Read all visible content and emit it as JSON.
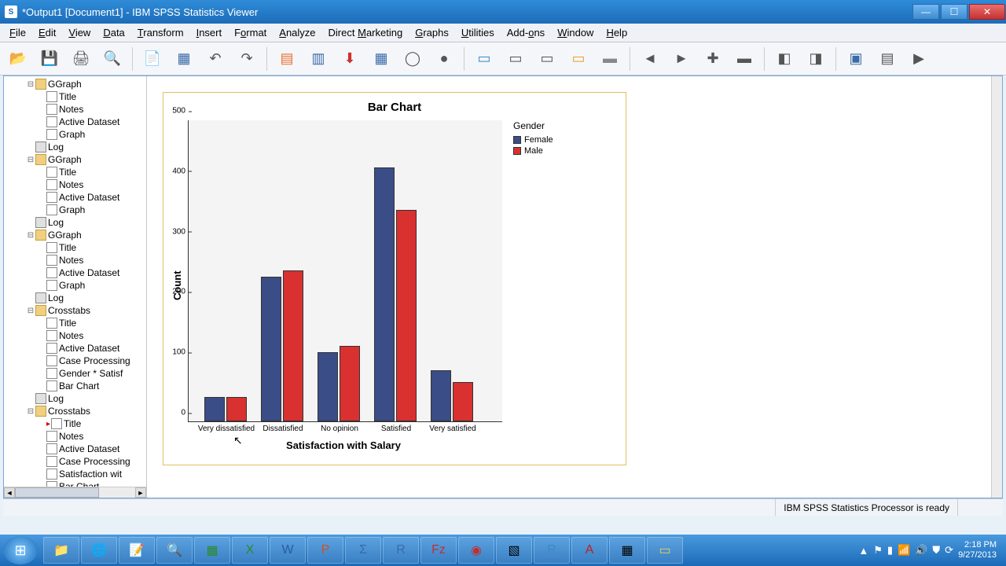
{
  "window": {
    "title": "*Output1 [Document1] - IBM SPSS Statistics Viewer"
  },
  "menu": {
    "file": "File",
    "edit": "Edit",
    "view": "View",
    "data": "Data",
    "transform": "Transform",
    "insert": "Insert",
    "format": "Format",
    "analyze": "Analyze",
    "direct_marketing": "Direct Marketing",
    "graphs": "Graphs",
    "utilities": "Utilities",
    "addons": "Add-ons",
    "window": "Window",
    "help": "Help"
  },
  "outline": {
    "items": [
      {
        "indent": 2,
        "twisty": "-",
        "ico": "book",
        "label": "GGraph"
      },
      {
        "indent": 3,
        "ico": "page",
        "label": "Title"
      },
      {
        "indent": 3,
        "ico": "page",
        "label": "Notes"
      },
      {
        "indent": 3,
        "ico": "page",
        "label": "Active Dataset"
      },
      {
        "indent": 3,
        "ico": "page",
        "label": "Graph"
      },
      {
        "indent": 2,
        "ico": "log",
        "label": "Log"
      },
      {
        "indent": 2,
        "twisty": "-",
        "ico": "book",
        "label": "GGraph"
      },
      {
        "indent": 3,
        "ico": "page",
        "label": "Title"
      },
      {
        "indent": 3,
        "ico": "page",
        "label": "Notes"
      },
      {
        "indent": 3,
        "ico": "page",
        "label": "Active Dataset"
      },
      {
        "indent": 3,
        "ico": "page",
        "label": "Graph"
      },
      {
        "indent": 2,
        "ico": "log",
        "label": "Log"
      },
      {
        "indent": 2,
        "twisty": "-",
        "ico": "book",
        "label": "GGraph"
      },
      {
        "indent": 3,
        "ico": "page",
        "label": "Title"
      },
      {
        "indent": 3,
        "ico": "page",
        "label": "Notes"
      },
      {
        "indent": 3,
        "ico": "page",
        "label": "Active Dataset"
      },
      {
        "indent": 3,
        "ico": "page",
        "label": "Graph"
      },
      {
        "indent": 2,
        "ico": "log",
        "label": "Log"
      },
      {
        "indent": 2,
        "twisty": "-",
        "ico": "book",
        "label": "Crosstabs"
      },
      {
        "indent": 3,
        "ico": "page",
        "label": "Title"
      },
      {
        "indent": 3,
        "ico": "page",
        "label": "Notes"
      },
      {
        "indent": 3,
        "ico": "page",
        "label": "Active Dataset"
      },
      {
        "indent": 3,
        "ico": "page",
        "label": "Case Processing"
      },
      {
        "indent": 3,
        "ico": "page",
        "label": "Gender * Satisf"
      },
      {
        "indent": 3,
        "ico": "page",
        "label": "Bar Chart"
      },
      {
        "indent": 2,
        "ico": "log",
        "label": "Log"
      },
      {
        "indent": 2,
        "twisty": "-",
        "ico": "book",
        "label": "Crosstabs"
      },
      {
        "indent": 3,
        "ico": "page",
        "label": "Title",
        "current": true
      },
      {
        "indent": 3,
        "ico": "page",
        "label": "Notes"
      },
      {
        "indent": 3,
        "ico": "page",
        "label": "Active Dataset"
      },
      {
        "indent": 3,
        "ico": "page",
        "label": "Case Processing"
      },
      {
        "indent": 3,
        "ico": "page",
        "label": "Satisfaction wit"
      },
      {
        "indent": 3,
        "ico": "page",
        "label": "Bar Chart"
      }
    ]
  },
  "chart_data": {
    "type": "bar",
    "title": "Bar Chart",
    "xlabel": "Satisfaction with Salary",
    "ylabel": "Count",
    "categories": [
      "Very dissatisfied",
      "Dissatisfied",
      "No opinion",
      "Satisfied",
      "Very satisfied"
    ],
    "series": [
      {
        "name": "Female",
        "color": "#3b4d87",
        "values": [
          40,
          240,
          115,
          420,
          85
        ]
      },
      {
        "name": "Male",
        "color": "#d93030",
        "values": [
          40,
          250,
          125,
          350,
          65
        ]
      }
    ],
    "legend_title": "Gender",
    "ylim": [
      0,
      500
    ],
    "yticks": [
      0,
      100,
      200,
      300,
      400,
      500
    ]
  },
  "status": {
    "processor": "IBM SPSS Statistics Processor is ready"
  },
  "tray": {
    "time": "2:18 PM",
    "date": "9/27/2013"
  }
}
